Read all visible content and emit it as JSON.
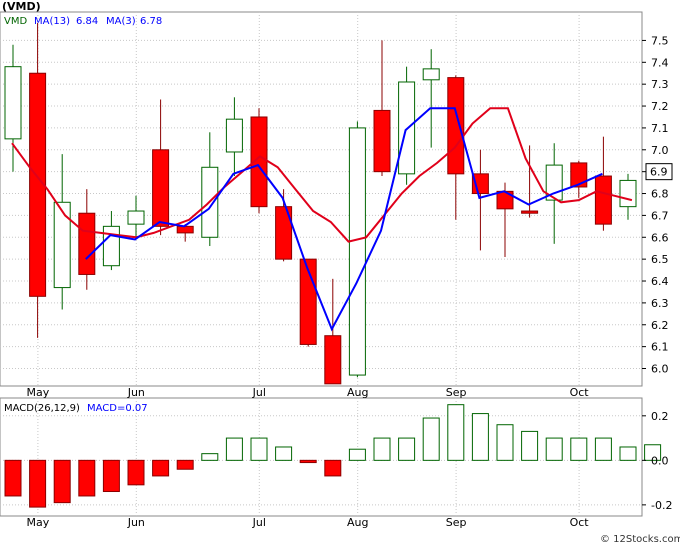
{
  "chart_data": [
    {
      "type": "candlestick",
      "title": "(VMD)",
      "ticker": "VMD",
      "indicators": [
        {
          "label": "MA(13)",
          "value": "6.84",
          "color": "#e0001a"
        },
        {
          "label": "MA(3)",
          "value": "6.78",
          "color": "#0000ff"
        }
      ],
      "last_price_label": "6.9",
      "yaxis_ticks": [
        "7.5",
        "7.4",
        "7.3",
        "7.2",
        "7.1",
        "7.0",
        "6.9",
        "6.8",
        "6.7",
        "6.6",
        "6.5",
        "6.4",
        "6.3",
        "6.2",
        "6.1",
        "6.0"
      ],
      "ylim": [
        5.92,
        7.63
      ],
      "x_labels": [
        {
          "label": "May",
          "week": 1
        },
        {
          "label": "Jun",
          "week": 5
        },
        {
          "label": "Jul",
          "week": 10
        },
        {
          "label": "Aug",
          "week": 14
        },
        {
          "label": "Sep",
          "week": 18
        },
        {
          "label": "Oct",
          "week": 23
        }
      ],
      "candles": [
        {
          "o": 7.05,
          "h": 7.48,
          "l": 6.9,
          "c": 7.38
        },
        {
          "o": 7.35,
          "h": 7.58,
          "l": 6.14,
          "c": 6.33
        },
        {
          "o": 6.37,
          "h": 6.98,
          "l": 6.27,
          "c": 6.76
        },
        {
          "o": 6.71,
          "h": 6.82,
          "l": 6.36,
          "c": 6.43
        },
        {
          "o": 6.47,
          "h": 6.72,
          "l": 6.45,
          "c": 6.65
        },
        {
          "o": 6.66,
          "h": 6.79,
          "l": 6.6,
          "c": 6.72
        },
        {
          "o": 7.0,
          "h": 7.23,
          "l": 6.61,
          "c": 6.65
        },
        {
          "o": 6.65,
          "h": 6.66,
          "l": 6.58,
          "c": 6.62
        },
        {
          "o": 6.6,
          "h": 7.08,
          "l": 6.56,
          "c": 6.92
        },
        {
          "o": 6.99,
          "h": 7.24,
          "l": 6.88,
          "c": 7.14
        },
        {
          "o": 7.15,
          "h": 7.19,
          "l": 6.71,
          "c": 6.74
        },
        {
          "o": 6.74,
          "h": 6.82,
          "l": 6.49,
          "c": 6.5
        },
        {
          "o": 6.5,
          "h": 6.5,
          "l": 6.1,
          "c": 6.11
        },
        {
          "o": 6.15,
          "h": 6.41,
          "l": 5.93,
          "c": 5.93
        },
        {
          "o": 5.97,
          "h": 7.13,
          "l": 5.96,
          "c": 7.1
        },
        {
          "o": 7.18,
          "h": 7.5,
          "l": 6.88,
          "c": 6.9
        },
        {
          "o": 6.89,
          "h": 7.38,
          "l": 6.84,
          "c": 7.31
        },
        {
          "o": 7.32,
          "h": 7.46,
          "l": 7.01,
          "c": 7.37
        },
        {
          "o": 7.33,
          "h": 7.34,
          "l": 6.68,
          "c": 6.89
        },
        {
          "o": 6.89,
          "h": 7.0,
          "l": 6.54,
          "c": 6.8
        },
        {
          "o": 6.81,
          "h": 6.85,
          "l": 6.51,
          "c": 6.73
        },
        {
          "o": 6.72,
          "h": 7.02,
          "l": 6.69,
          "c": 6.71
        },
        {
          "o": 6.77,
          "h": 7.03,
          "l": 6.57,
          "c": 6.93
        },
        {
          "o": 6.94,
          "h": 6.95,
          "l": 6.78,
          "c": 6.83
        },
        {
          "o": 6.88,
          "h": 7.06,
          "l": 6.63,
          "c": 6.66
        },
        {
          "o": 6.74,
          "h": 6.89,
          "l": 6.68,
          "c": 6.86
        }
      ],
      "series": [
        {
          "name": "MA(13)",
          "color": "#e0001a",
          "values": [
            7.03,
            6.92,
            6.82,
            6.7,
            6.63,
            6.62,
            6.61,
            6.6,
            6.62,
            6.65,
            6.68,
            6.75,
            6.83,
            6.9,
            6.97,
            6.92,
            6.82,
            6.72,
            6.67,
            6.58,
            6.6,
            6.7,
            6.8,
            6.88,
            6.94,
            7.01,
            7.12,
            7.19,
            7.19,
            6.96,
            6.81,
            6.76,
            6.77,
            6.81,
            6.79,
            6.77
          ]
        },
        {
          "name": "MA(3)",
          "color": "#0000ff",
          "values": [
            null,
            null,
            null,
            6.5,
            6.61,
            6.59,
            6.67,
            6.65,
            6.73,
            6.89,
            6.93,
            6.78,
            6.46,
            6.18,
            6.39,
            6.63,
            7.09,
            7.19,
            7.19,
            6.78,
            6.81,
            6.75,
            6.8,
            6.84,
            6.89
          ]
        }
      ]
    },
    {
      "type": "bar",
      "title": "MACD(26,12,9)",
      "label": "MACD(26,12,9)",
      "value_label": "MACD=0.07",
      "yaxis_ticks": [
        "0.2",
        "0.0",
        "-0.2"
      ],
      "ylim": [
        -0.25,
        0.28
      ],
      "values": [
        -0.16,
        -0.21,
        -0.19,
        -0.16,
        -0.14,
        -0.11,
        -0.07,
        -0.04,
        0.03,
        0.1,
        0.1,
        0.06,
        -0.01,
        -0.07,
        0.05,
        0.1,
        0.1,
        0.19,
        0.25,
        0.21,
        0.16,
        0.13,
        0.1,
        0.1,
        0.1,
        0.06,
        0.07
      ],
      "colors": {
        "negative": "#ff0000",
        "positive_edge": "#006400"
      }
    }
  ],
  "footer": {
    "watermark": "© 12Stocks.com"
  }
}
